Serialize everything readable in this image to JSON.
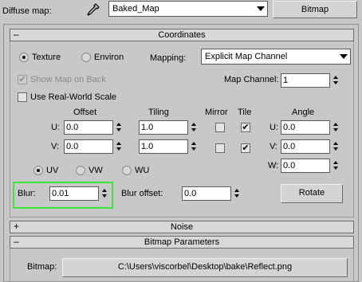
{
  "top": {
    "diffuse_label": "Diffuse map:",
    "map_name": "Baked_Map",
    "map_type": "Bitmap"
  },
  "coordinates": {
    "header": "Coordinates",
    "collapse_sign": "–",
    "texture_label": "Texture",
    "environ_label": "Environ",
    "mapping_label": "Mapping:",
    "mapping_value": "Explicit Map Channel",
    "show_map_on_back": "Show Map on Back",
    "map_channel_label": "Map Channel:",
    "map_channel_value": "1",
    "use_real_world_scale": "Use Real-World Scale",
    "col_offset": "Offset",
    "col_tiling": "Tiling",
    "col_mirror": "Mirror",
    "col_tile": "Tile",
    "col_angle": "Angle",
    "u_label": "U:",
    "v_label": "V:",
    "w_label": "W:",
    "u_offset": "0.0",
    "v_offset": "0.0",
    "u_tiling": "1.0",
    "v_tiling": "1.0",
    "u_tile_check": "✔",
    "v_tile_check": "✔",
    "u_angle": "0.0",
    "v_angle": "0.0",
    "w_angle": "0.0",
    "uv_label": "UV",
    "vw_label": "VW",
    "wu_label": "WU",
    "blur_label": "Blur:",
    "blur_value": "0.01",
    "blur_offset_label": "Blur offset:",
    "blur_offset_value": "0.0",
    "rotate_label": "Rotate"
  },
  "noise": {
    "header": "Noise",
    "expand_sign": "+"
  },
  "bitmap_params": {
    "header": "Bitmap Parameters",
    "collapse_sign": "–",
    "bitmap_label": "Bitmap:",
    "bitmap_path": "C:\\Users\\viscorbel\\Desktop\\bake\\Reflect.png"
  },
  "colors": {
    "highlight": "#3ce63c",
    "panel_bg": "#c8c8c8"
  },
  "icons": {
    "eyedropper": "eyedropper-icon"
  }
}
